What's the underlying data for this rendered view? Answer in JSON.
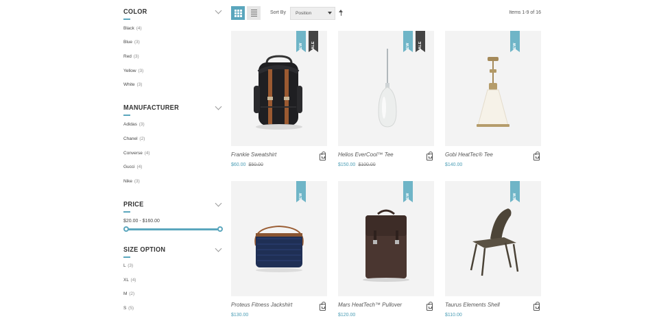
{
  "filters": {
    "color": {
      "title": "COLOR",
      "options": [
        {
          "label": "Black",
          "count": "(4)"
        },
        {
          "label": "Blue",
          "count": "(3)"
        },
        {
          "label": "Red",
          "count": "(3)"
        },
        {
          "label": "Yellow",
          "count": "(3)"
        },
        {
          "label": "White",
          "count": "(3)"
        }
      ]
    },
    "manufacturer": {
      "title": "MANUFACTURER",
      "options": [
        {
          "label": "Adidas",
          "count": "(3)"
        },
        {
          "label": "Chanel",
          "count": "(2)"
        },
        {
          "label": "Converse",
          "count": "(4)"
        },
        {
          "label": "Gucci",
          "count": "(4)"
        },
        {
          "label": "Nike",
          "count": "(3)"
        }
      ]
    },
    "price": {
      "title": "PRICE",
      "range": "$20.00 - $160.00"
    },
    "size": {
      "title": "SIZE OPTION",
      "options": [
        {
          "label": "L",
          "count": "(3)"
        },
        {
          "label": "XL",
          "count": "(4)"
        },
        {
          "label": "M",
          "count": "(2)"
        },
        {
          "label": "S",
          "count": "(5)"
        }
      ]
    }
  },
  "toolbar": {
    "sort_label": "Sort By",
    "sort_value": "Position",
    "items_count": "Items 1-9 of 16",
    "grid_icon": "grid-icon",
    "list_icon": "list-icon"
  },
  "products": [
    {
      "name": "Frankie Sweatshirt",
      "price": "$60.00",
      "old_price": "$50.00",
      "badges": [
        "NEW",
        "SALE"
      ],
      "image": "backpack"
    },
    {
      "name": "Helios EverCool™ Tee",
      "price": "$150.00",
      "old_price": "$100.00",
      "badges": [
        "NEW",
        "SALE"
      ],
      "image": "bulb-lamp"
    },
    {
      "name": "Gobi HeatTec® Tee",
      "price": "$140.00",
      "old_price": "",
      "badges": [
        "NEW"
      ],
      "image": "pendant-lamp"
    },
    {
      "name": "Proteus Fitness Jackshirt",
      "price": "$130.00",
      "old_price": "",
      "badges": [
        "NEW"
      ],
      "image": "woven-bag"
    },
    {
      "name": "Mars HeatTech™ Pullover",
      "price": "$120.00",
      "old_price": "",
      "badges": [
        "NEW"
      ],
      "image": "leather-backpack"
    },
    {
      "name": "Taurus Elements Shell",
      "price": "$110.00",
      "old_price": "",
      "badges": [
        "NEW"
      ],
      "image": "chair"
    }
  ],
  "colors": {
    "accent": "#5aa6bd",
    "new_badge": "#6fb5c7",
    "sale_badge": "#444444",
    "price": "#4a9db5"
  }
}
